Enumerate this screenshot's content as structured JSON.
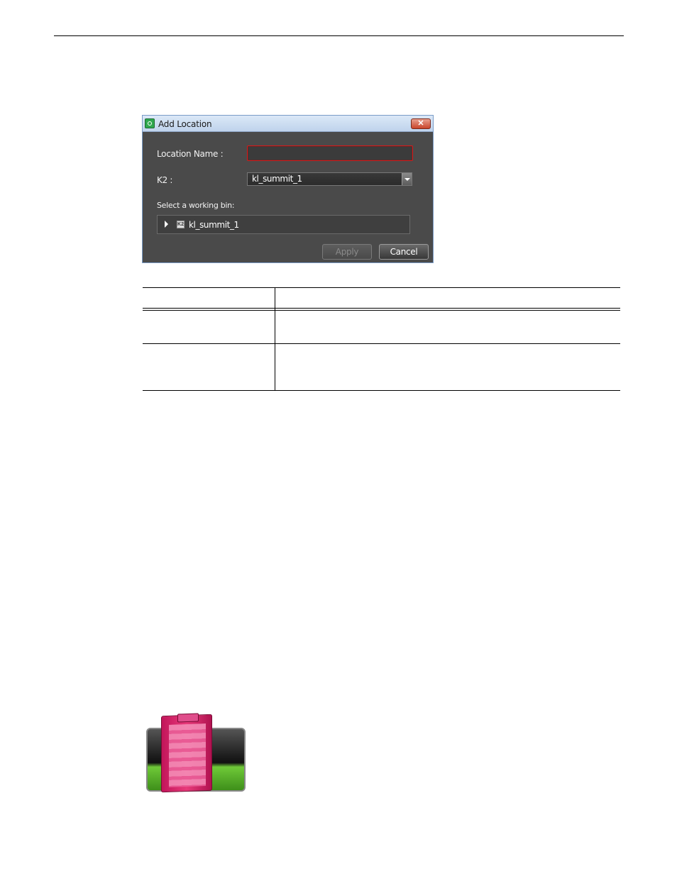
{
  "dialog": {
    "title": "Add Location",
    "close_glyph": "✕",
    "location_name_label": "Location Name :",
    "location_name_value": "",
    "k2_label": "K2 :",
    "k2_selected": "kl_summit_1",
    "working_bin_label": "Select a working bin:",
    "tree_node": "kl_summit_1",
    "apply_label": "Apply",
    "cancel_label": "Cancel",
    "icons": [
      "app-icon",
      "close-icon",
      "chevron-down-icon",
      "expand-arrow-icon",
      "server-icon"
    ],
    "colors": {
      "dialog_bg": "#4a4a4a",
      "required_border": "#d21c1c",
      "titlebar": "#bfd3ec"
    }
  },
  "page_icon": {
    "name": "clipboard-icon"
  }
}
